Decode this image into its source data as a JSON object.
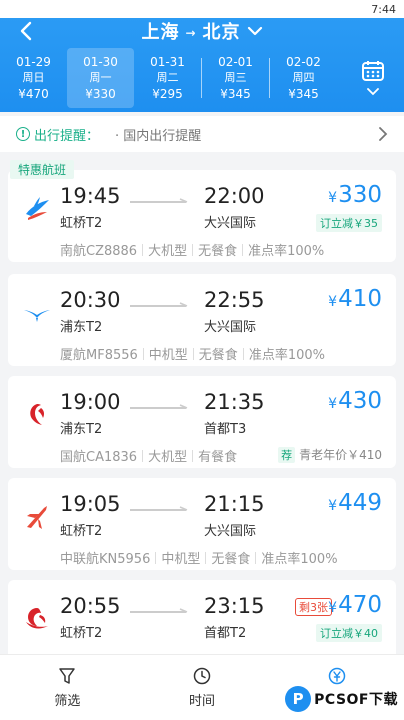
{
  "status_bar": {
    "time": "7:44"
  },
  "header": {
    "from": "上海",
    "to": "北京",
    "arrow": "→"
  },
  "dates": [
    {
      "date": "01-29",
      "weekday": "周日",
      "price": "¥470",
      "active": false
    },
    {
      "date": "01-30",
      "weekday": "周一",
      "price": "¥330",
      "active": true
    },
    {
      "date": "01-31",
      "weekday": "周二",
      "price": "¥295",
      "active": false
    },
    {
      "date": "02-01",
      "weekday": "周三",
      "price": "¥345",
      "active": false
    },
    {
      "date": "02-02",
      "weekday": "周四",
      "price": "¥345",
      "active": false
    }
  ],
  "notice": {
    "title": "出行提醒：",
    "text": "· 国内出行提醒"
  },
  "section_tag": "特惠航班",
  "flights": [
    {
      "dep_time": "19:45",
      "dep_airport": "虹桥T2",
      "arr_time": "22:00",
      "arr_airport": "大兴国际",
      "currency": "¥",
      "price": "330",
      "promo": "订立减￥35",
      "info": [
        "南航CZ8886",
        "大机型",
        "无餐食",
        "准点率100%"
      ],
      "logo": "china-southern-logo"
    },
    {
      "dep_time": "20:30",
      "dep_airport": "浦东T2",
      "arr_time": "22:55",
      "arr_airport": "大兴国际",
      "currency": "¥",
      "price": "410",
      "info": [
        "厦航MF8556",
        "中机型",
        "无餐食",
        "准点率100%"
      ],
      "logo": "xiamen-airlines-logo"
    },
    {
      "dep_time": "19:00",
      "dep_airport": "浦东T2",
      "arr_time": "21:35",
      "arr_airport": "首都T3",
      "currency": "¥",
      "price": "430",
      "info": [
        "国航CA1836",
        "大机型",
        "有餐食"
      ],
      "senior_tag": "荐",
      "senior_text": "青老年价￥410",
      "logo": "air-china-logo"
    },
    {
      "dep_time": "19:05",
      "dep_airport": "虹桥T2",
      "arr_time": "21:15",
      "arr_airport": "大兴国际",
      "currency": "¥",
      "price": "449",
      "info": [
        "中联航KN5956",
        "中机型",
        "无餐食",
        "准点率100%"
      ],
      "logo": "china-united-logo"
    },
    {
      "dep_time": "20:55",
      "dep_airport": "虹桥T2",
      "arr_time": "23:15",
      "arr_airport": "首都T2",
      "currency": "¥",
      "price": "470",
      "seats_left": "剩3张",
      "promo": "订立减￥40",
      "info": [],
      "logo": "hainan-airlines-logo"
    }
  ],
  "bottom_tabs": [
    {
      "label": "筛选",
      "icon": "filter-icon"
    },
    {
      "label": "时间",
      "icon": "clock-icon"
    },
    {
      "label": "价格",
      "icon": "yen-icon"
    }
  ],
  "watermark": {
    "logo_letter": "P",
    "text": "PCSOF下载"
  },
  "colors": {
    "primary": "#1e8ff0",
    "green": "#17a67c",
    "red": "#e84b3a"
  }
}
